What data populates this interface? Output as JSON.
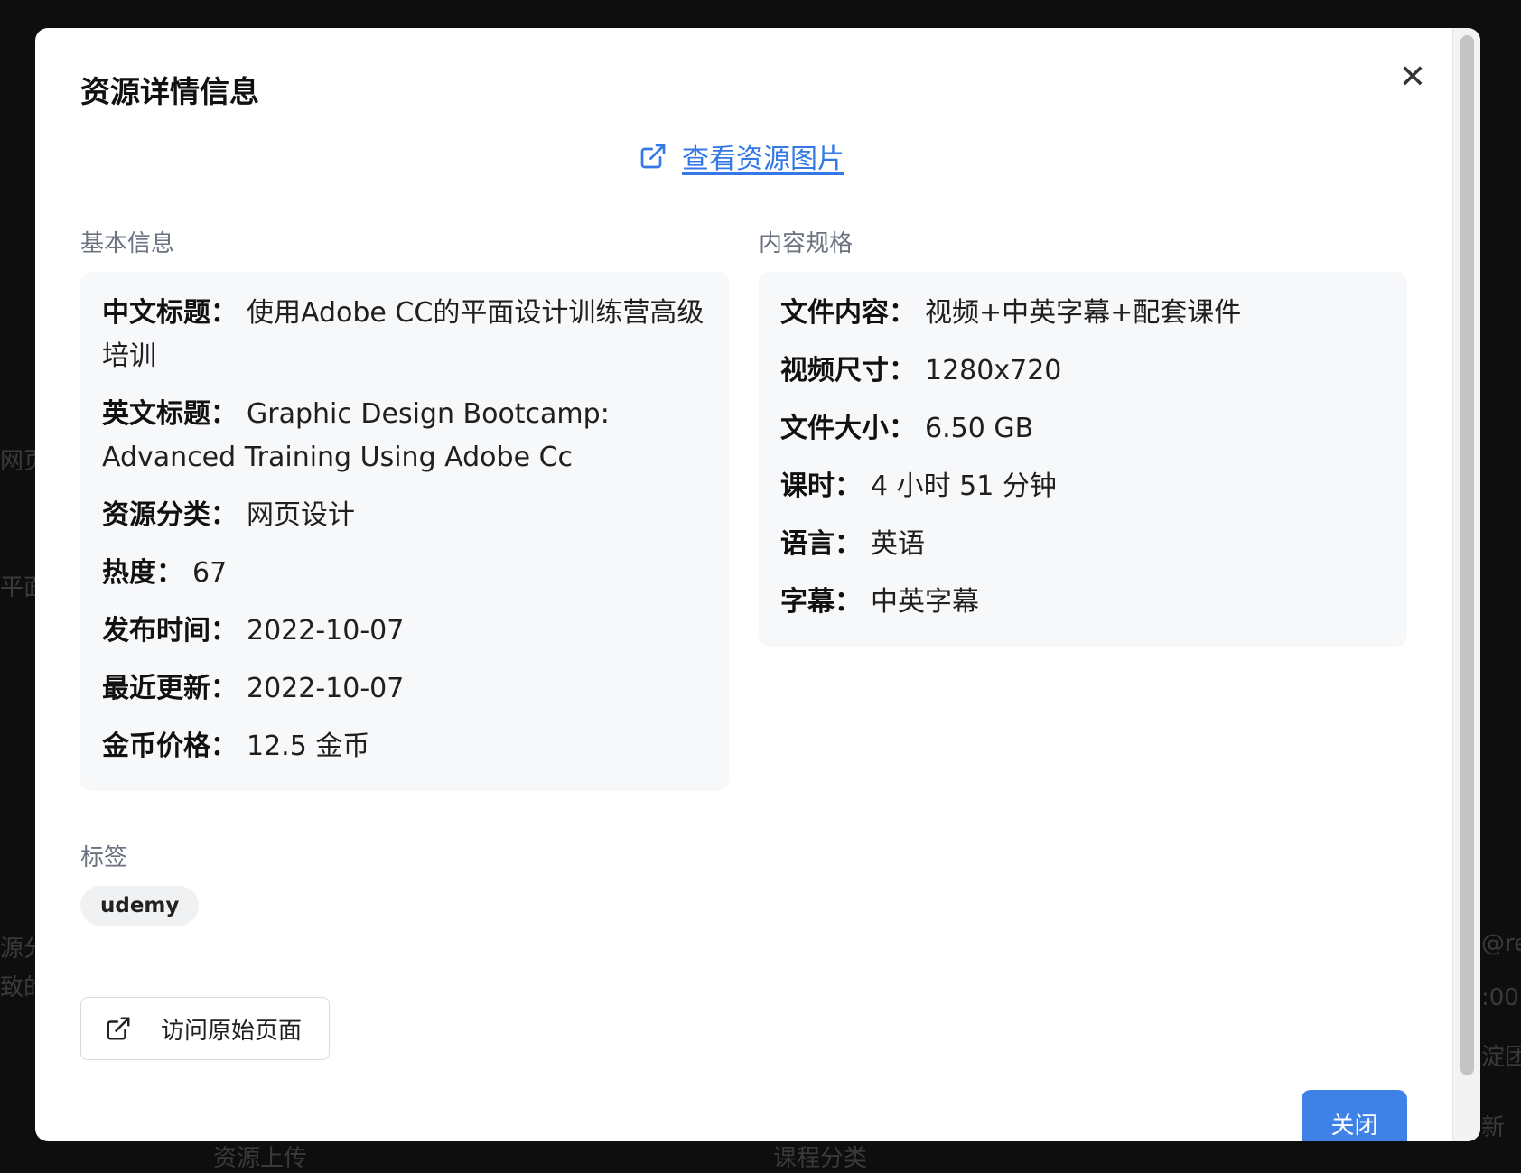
{
  "background": {
    "fragments": [
      "网页",
      "平面",
      "源分",
      "致的",
      "@re",
      ":00",
      "淀团",
      "新",
      "资源上传",
      "课程分类"
    ]
  },
  "modal": {
    "title": "资源详情信息",
    "view_image_link": "查看资源图片",
    "basic_info": {
      "label": "基本信息",
      "rows": [
        {
          "key": "中文标题：",
          "value": "使用Adobe CC的平面设计训练营高级培训"
        },
        {
          "key": "英文标题：",
          "value": "Graphic Design Bootcamp: Advanced Training Using Adobe Cc"
        },
        {
          "key": "资源分类：",
          "value": "网页设计"
        },
        {
          "key": "热度：",
          "value": "67"
        },
        {
          "key": "发布时间：",
          "value": "2022-10-07"
        },
        {
          "key": "最近更新：",
          "value": "2022-10-07"
        },
        {
          "key": "金币价格：",
          "value": "12.5 金币"
        }
      ]
    },
    "content_spec": {
      "label": "内容规格",
      "rows": [
        {
          "key": "文件内容：",
          "value": "视频+中英字幕+配套课件"
        },
        {
          "key": "视频尺寸：",
          "value": "1280x720"
        },
        {
          "key": "文件大小：",
          "value": "6.50 GB"
        },
        {
          "key": "课时：",
          "value": "4 小时 51 分钟"
        },
        {
          "key": "语言：",
          "value": "英语"
        },
        {
          "key": "字幕：",
          "value": "中英字幕"
        }
      ]
    },
    "tags": {
      "label": "标签",
      "items": [
        "udemy"
      ]
    },
    "visit_button": "访问原始页面",
    "close_button": "关闭",
    "close_icon": "close-icon"
  },
  "colors": {
    "accent": "#3e82e8",
    "link": "#3478e6",
    "card_bg": "#f7f8fa",
    "muted_label": "#6b7280"
  }
}
